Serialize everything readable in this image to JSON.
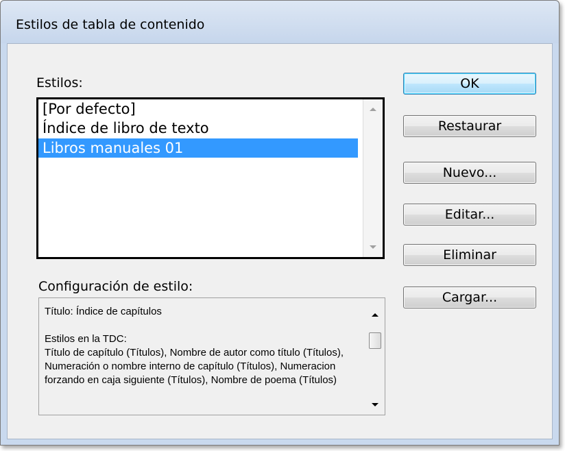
{
  "window": {
    "title": "Estilos de tabla de contenido"
  },
  "styles": {
    "label": "Estilos:",
    "items": [
      {
        "label": "[Por defecto]",
        "selected": false
      },
      {
        "label": "Índice de libro de texto",
        "selected": false
      },
      {
        "label": "Libros manuales 01",
        "selected": true
      }
    ]
  },
  "settings": {
    "label": "Configuración de estilo:",
    "text": "Título: Índice de capítulos\n\nEstilos en la TDC:\nTítulo de capítulo (Títulos), Nombre de autor como título (Títulos), Numeración o nombre interno de capítulo (Títulos), Numeracion forzando en caja siguiente (Títulos), Nombre de poema (Títulos)"
  },
  "buttons": {
    "ok": "OK",
    "restaurar": "Restaurar",
    "nuevo": "Nuevo...",
    "editar": "Editar...",
    "eliminar": "Eliminar",
    "cargar": "Cargar..."
  },
  "icons": {
    "scroll_up": "scroll-up-arrow-icon",
    "scroll_down": "scroll-down-arrow-icon"
  },
  "colors": {
    "selection": "#3399ff",
    "default_button": "#bee6fd"
  }
}
